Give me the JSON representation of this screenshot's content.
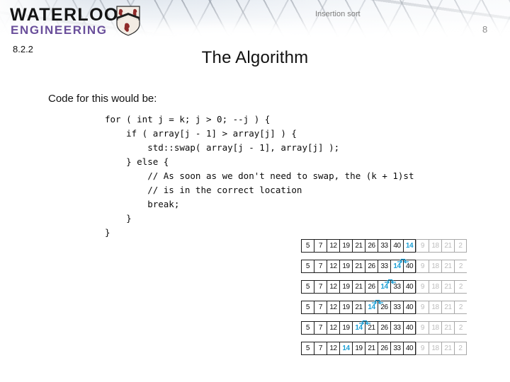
{
  "header": {
    "logo_line1": "WATERLOO",
    "logo_line2": "ENGINEERING",
    "crest_name": "waterloo-shield-crest",
    "breadcrumb": "Insertion sort",
    "page_number": "8",
    "section_number": "8.2.2",
    "title": "The Algorithm",
    "accent_purple": "#6a4f9b",
    "crest_red": "#8f2a2a"
  },
  "body": {
    "lead": "Code for this would be:",
    "code_lines": [
      "for ( int j = k; j > 0; --j ) {",
      "    if ( array[j - 1] > array[j] ) {",
      "        std::swap( array[j - 1], array[j] );",
      "    } else {",
      "        // As soon as we don't need to swap, the (k + 1)st",
      "        // is in the correct location",
      "        break;",
      "    }",
      "}"
    ]
  },
  "figure": {
    "name": "insertion-sort-swap-trace",
    "key_value": "14",
    "key_color": "#1a9ed4",
    "faded_color": "#bdbdbd",
    "unsorted_tail": [
      "9",
      "18",
      "21",
      "2"
    ],
    "rows": [
      {
        "cells": [
          "5",
          "7",
          "12",
          "19",
          "21",
          "26",
          "33",
          "40",
          "14",
          "9",
          "18",
          "21",
          "2"
        ],
        "key_index": 8,
        "faded_from": 9,
        "swap_boundary": null
      },
      {
        "cells": [
          "5",
          "7",
          "12",
          "19",
          "21",
          "26",
          "33",
          "14",
          "40",
          "9",
          "18",
          "21",
          "2"
        ],
        "key_index": 7,
        "faded_from": 9,
        "swap_boundary": 7
      },
      {
        "cells": [
          "5",
          "7",
          "12",
          "19",
          "21",
          "26",
          "14",
          "33",
          "40",
          "9",
          "18",
          "21",
          "2"
        ],
        "key_index": 6,
        "faded_from": 9,
        "swap_boundary": 6
      },
      {
        "cells": [
          "5",
          "7",
          "12",
          "19",
          "21",
          "14",
          "26",
          "33",
          "40",
          "9",
          "18",
          "21",
          "2"
        ],
        "key_index": 5,
        "faded_from": 9,
        "swap_boundary": 5
      },
      {
        "cells": [
          "5",
          "7",
          "12",
          "19",
          "14",
          "21",
          "26",
          "33",
          "40",
          "9",
          "18",
          "21",
          "2"
        ],
        "key_index": 4,
        "faded_from": 9,
        "swap_boundary": 4
      },
      {
        "cells": [
          "5",
          "7",
          "12",
          "14",
          "19",
          "21",
          "26",
          "33",
          "40",
          "9",
          "18",
          "21",
          "2"
        ],
        "key_index": 3,
        "faded_from": 9,
        "swap_boundary": null
      }
    ]
  }
}
